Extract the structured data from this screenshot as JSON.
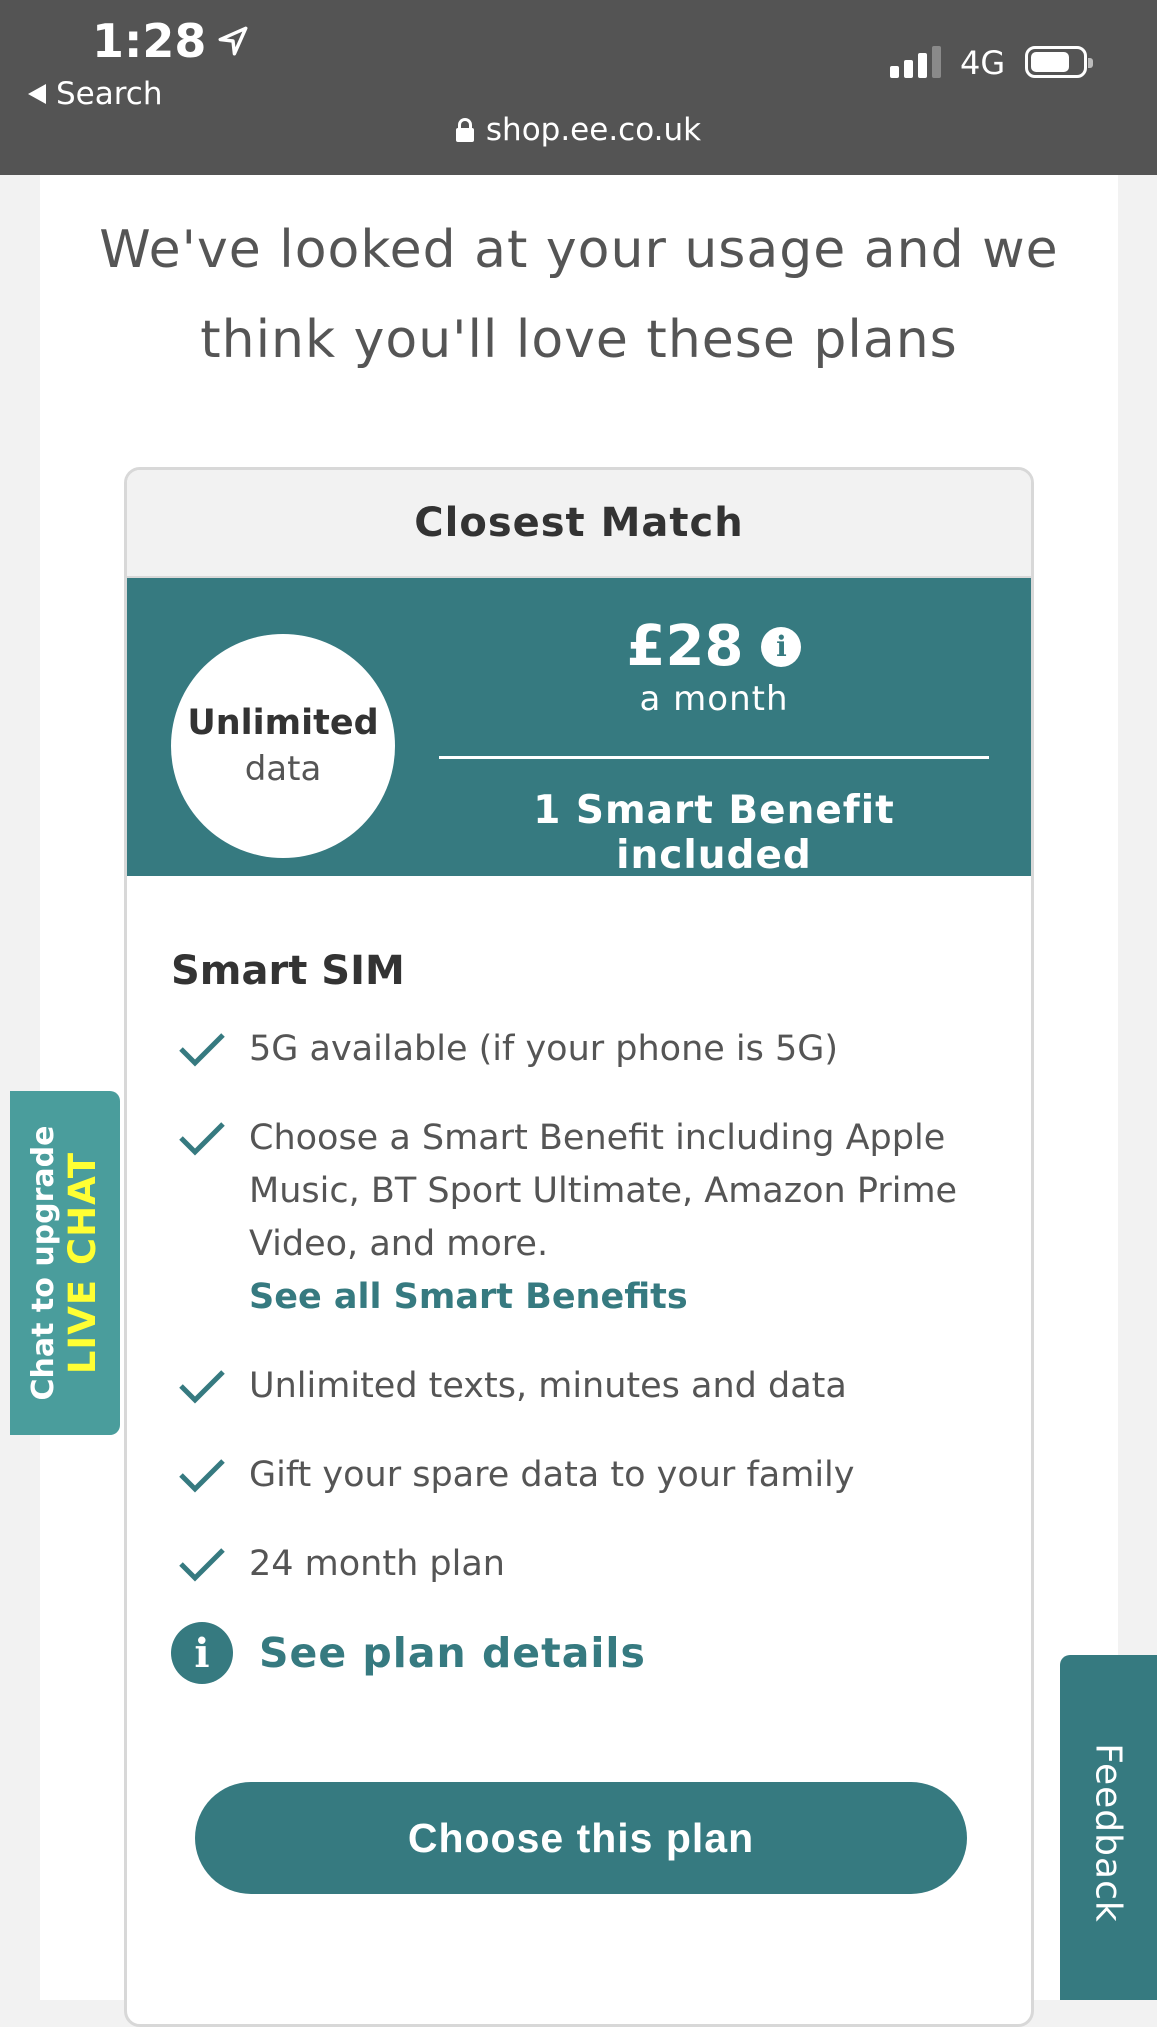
{
  "status_bar": {
    "time": "1:28",
    "back_label": "Search",
    "network": "4G",
    "url": "shop.ee.co.uk"
  },
  "page": {
    "heading_line1": "We've looked at your usage and we",
    "heading_line2": "think you'll love these plans"
  },
  "card": {
    "header": "Closest Match",
    "data_big": "Unlimited",
    "data_small": "data",
    "price": "£28",
    "price_period": "a month",
    "benefit_summary": "1 Smart Benefit included",
    "plan_name": "Smart SIM",
    "features": [
      "5G available (if your phone is 5G)",
      "Choose a Smart Benefit including Apple Music, BT Sport Ultimate, Amazon Prime Video, and more.",
      "Unlimited texts, minutes and data",
      "Gift your spare data to your family",
      "24 month plan"
    ],
    "benefits_link": "See all Smart Benefits",
    "details_link": "See plan details",
    "cta": "Choose this plan"
  },
  "side_tabs": {
    "chat_line1": "Chat to upgrade",
    "chat_line2": "LIVE CHAT",
    "feedback": "Feedback"
  },
  "colors": {
    "brand_teal": "#367a80",
    "chat_teal": "#4a9d9c",
    "chat_yellow": "#ffff33",
    "status_bar": "#545454"
  }
}
